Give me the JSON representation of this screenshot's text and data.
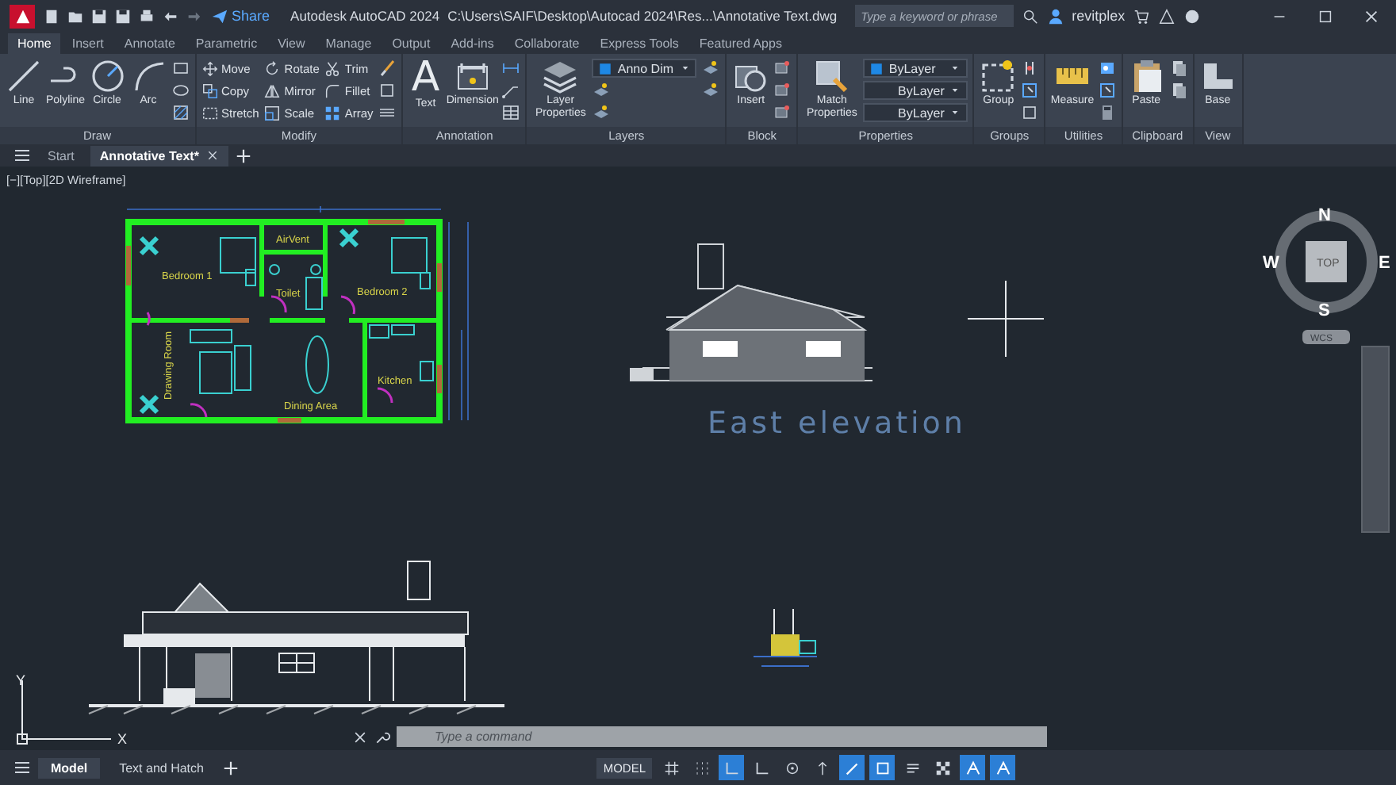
{
  "title_bar": {
    "share": "Share",
    "app_title": "Autodesk AutoCAD 2024",
    "file_path": "C:\\Users\\SAIF\\Desktop\\Autocad 2024\\Res...\\Annotative Text.dwg",
    "search": {
      "placeholder": "Type a keyword or phrase"
    },
    "user": "revitplex"
  },
  "ribbon_tabs": [
    {
      "label": "Home",
      "selected": true
    },
    {
      "label": "Insert",
      "selected": false
    },
    {
      "label": "Annotate",
      "selected": false
    },
    {
      "label": "Parametric",
      "selected": false
    },
    {
      "label": "View",
      "selected": false
    },
    {
      "label": "Manage",
      "selected": false
    },
    {
      "label": "Output",
      "selected": false
    },
    {
      "label": "Add-ins",
      "selected": false
    },
    {
      "label": "Collaborate",
      "selected": false
    },
    {
      "label": "Express Tools",
      "selected": false
    },
    {
      "label": "Featured Apps",
      "selected": false
    }
  ],
  "ribbon_panels": [
    {
      "title": "Draw",
      "tools": [
        {
          "kind": "large",
          "label": "Line"
        },
        {
          "kind": "large",
          "label": "Polyline"
        },
        {
          "kind": "large",
          "label": "Circle"
        },
        {
          "kind": "large",
          "label": "Arc"
        },
        {
          "kind": "icon"
        },
        {
          "kind": "icon"
        },
        {
          "kind": "icon"
        }
      ]
    },
    {
      "title": "Modify",
      "tools": [
        {
          "kind": "small",
          "label": "Move"
        },
        {
          "kind": "small",
          "label": "Copy"
        },
        {
          "kind": "small",
          "label": "Stretch"
        },
        {
          "kind": "small",
          "label": "Rotate"
        },
        {
          "kind": "small",
          "label": "Mirror"
        },
        {
          "kind": "small",
          "label": "Scale"
        },
        {
          "kind": "small",
          "label": "Trim"
        },
        {
          "kind": "small",
          "label": "Fillet"
        },
        {
          "kind": "small",
          "label": "Array"
        },
        {
          "kind": "icon"
        },
        {
          "kind": "icon"
        },
        {
          "kind": "icon"
        }
      ]
    },
    {
      "title": "Annotation",
      "tools": [
        {
          "kind": "large",
          "label": "Text",
          "glyph": "A"
        },
        {
          "kind": "large",
          "label": "Dimension"
        },
        {
          "kind": "icon"
        },
        {
          "kind": "icon"
        },
        {
          "kind": "icon"
        }
      ]
    },
    {
      "title": "Layers",
      "tools": [
        {
          "kind": "large",
          "label": "Layer Properties"
        },
        {
          "kind": "dropdown",
          "value": "Anno Dim"
        },
        {
          "kind": "icon"
        },
        {
          "kind": "icon"
        },
        {
          "kind": "icon"
        },
        {
          "kind": "icon"
        }
      ]
    },
    {
      "title": "Block",
      "tools": [
        {
          "kind": "large",
          "label": "Insert"
        },
        {
          "kind": "icon"
        },
        {
          "kind": "icon"
        },
        {
          "kind": "icon"
        }
      ]
    },
    {
      "title": "Properties",
      "tools": [
        {
          "kind": "large",
          "label": "Match Properties"
        },
        {
          "kind": "color-dropdown",
          "value": "ByLayer"
        },
        {
          "kind": "line-dropdown",
          "value": "ByLayer"
        },
        {
          "kind": "line-dropdown",
          "value": "ByLayer"
        }
      ]
    },
    {
      "title": "Groups",
      "tools": [
        {
          "kind": "large",
          "label": "Group"
        },
        {
          "kind": "icon"
        },
        {
          "kind": "icon"
        },
        {
          "kind": "icon"
        }
      ]
    },
    {
      "title": "Utilities",
      "tools": [
        {
          "kind": "large",
          "label": "Measure"
        },
        {
          "kind": "icon"
        },
        {
          "kind": "icon"
        },
        {
          "kind": "icon"
        }
      ]
    },
    {
      "title": "Clipboard",
      "tools": [
        {
          "kind": "large",
          "label": "Paste"
        },
        {
          "kind": "icon"
        },
        {
          "kind": "icon"
        }
      ]
    },
    {
      "title": "View",
      "tools": [
        {
          "kind": "large",
          "label": "Base"
        }
      ]
    }
  ],
  "file_tabs": [
    {
      "label": "Start",
      "selected": false
    },
    {
      "label": "Annotative Text*",
      "selected": true
    }
  ],
  "viewport": {
    "label": "[−][Top][2D Wireframe]",
    "plan_labels": [
      "Bedroom 1",
      "AirVent",
      "Toilet",
      "Bedroom 2",
      "Drawing Room",
      "Dining Area",
      "Kitchen"
    ],
    "elevation_title": "East elevation"
  },
  "viewcube": {
    "face": "TOP",
    "north": "N",
    "south": "S",
    "east": "E",
    "west": "W",
    "ucs": "WCS"
  },
  "ucs_icon": {
    "x": "X",
    "y": "Y"
  },
  "command_line": {
    "placeholder": "Type a command"
  },
  "status_bar": {
    "layout_tabs": [
      {
        "label": "Model",
        "selected": true
      },
      {
        "label": "Text and Hatch",
        "selected": false
      }
    ],
    "space": "MODEL",
    "toggles": [
      {
        "on": false
      },
      {
        "on": false
      },
      {
        "on": true
      },
      {
        "on": false
      },
      {
        "on": false
      },
      {
        "on": false
      },
      {
        "on": true
      },
      {
        "on": true
      },
      {
        "on": false
      },
      {
        "on": false
      },
      {
        "on": true
      },
      {
        "on": true
      }
    ]
  }
}
